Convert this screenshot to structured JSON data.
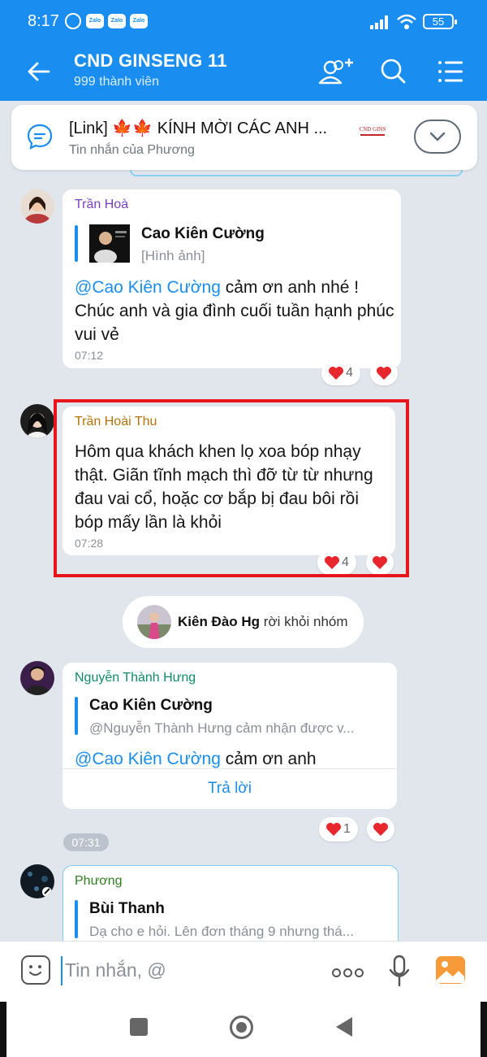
{
  "status_bar": {
    "time": "8:17",
    "zalo_icon_label": "Zalo",
    "battery": "55"
  },
  "header": {
    "title": "CND GINSENG 11",
    "subtitle": "999 thành viên"
  },
  "pinned": {
    "title": "[Link] 🍁🍁 KÍNH MỜI CÁC ANH ...",
    "subtitle": "Tin nhắn của Phương",
    "logo_text": "CND GINS"
  },
  "messages": [
    {
      "sender": "Trần Hoà",
      "sender_color": "#7b3fbf",
      "quote": {
        "name": "Cao Kiên Cường",
        "text": "[Hình ảnh]"
      },
      "mention": "@Cao Kiên Cường",
      "text_line1": " cảm ơn anh nhé !",
      "text_rest": "Chúc anh và gia đình cuối tuần hạnh phúc vui vẻ",
      "time": "07:12",
      "reaction_count": "4"
    },
    {
      "sender": "Trần Hoài Thu",
      "sender_color": "#b3720a",
      "text": "Hôm qua khách khen lọ xoa bóp nhạy thật. Giãn tĩnh mạch thì đỡ từ từ nhưng đau vai cổ, hoặc cơ bắp bị đau bôi rồi bóp mấy lần là khỏi",
      "time": "07:28",
      "reaction_count": "4"
    },
    {
      "sender": "Nguyễn Thành Hưng",
      "sender_color": "#0e8a6a",
      "quote": {
        "name": "Cao Kiên Cường",
        "text": "@Nguyễn Thành Hưng cảm nhận được v..."
      },
      "mention": "@Cao Kiên Cường",
      "text": " cảm ơn anh",
      "reply_label": "Trả lời",
      "time": "07:31",
      "reaction_count": "1"
    },
    {
      "sender": "Phương",
      "sender_color": "#2f7d1f",
      "quote": {
        "name": "Bùi Thanh",
        "text": "Dạ cho e hỏi. Lên đơn tháng 9 nhưng thá..."
      }
    }
  ],
  "system_message": {
    "name": "Kiên Đào Hg",
    "text": " rời khỏi nhóm"
  },
  "input": {
    "placeholder": "Tin nhắn, @"
  }
}
